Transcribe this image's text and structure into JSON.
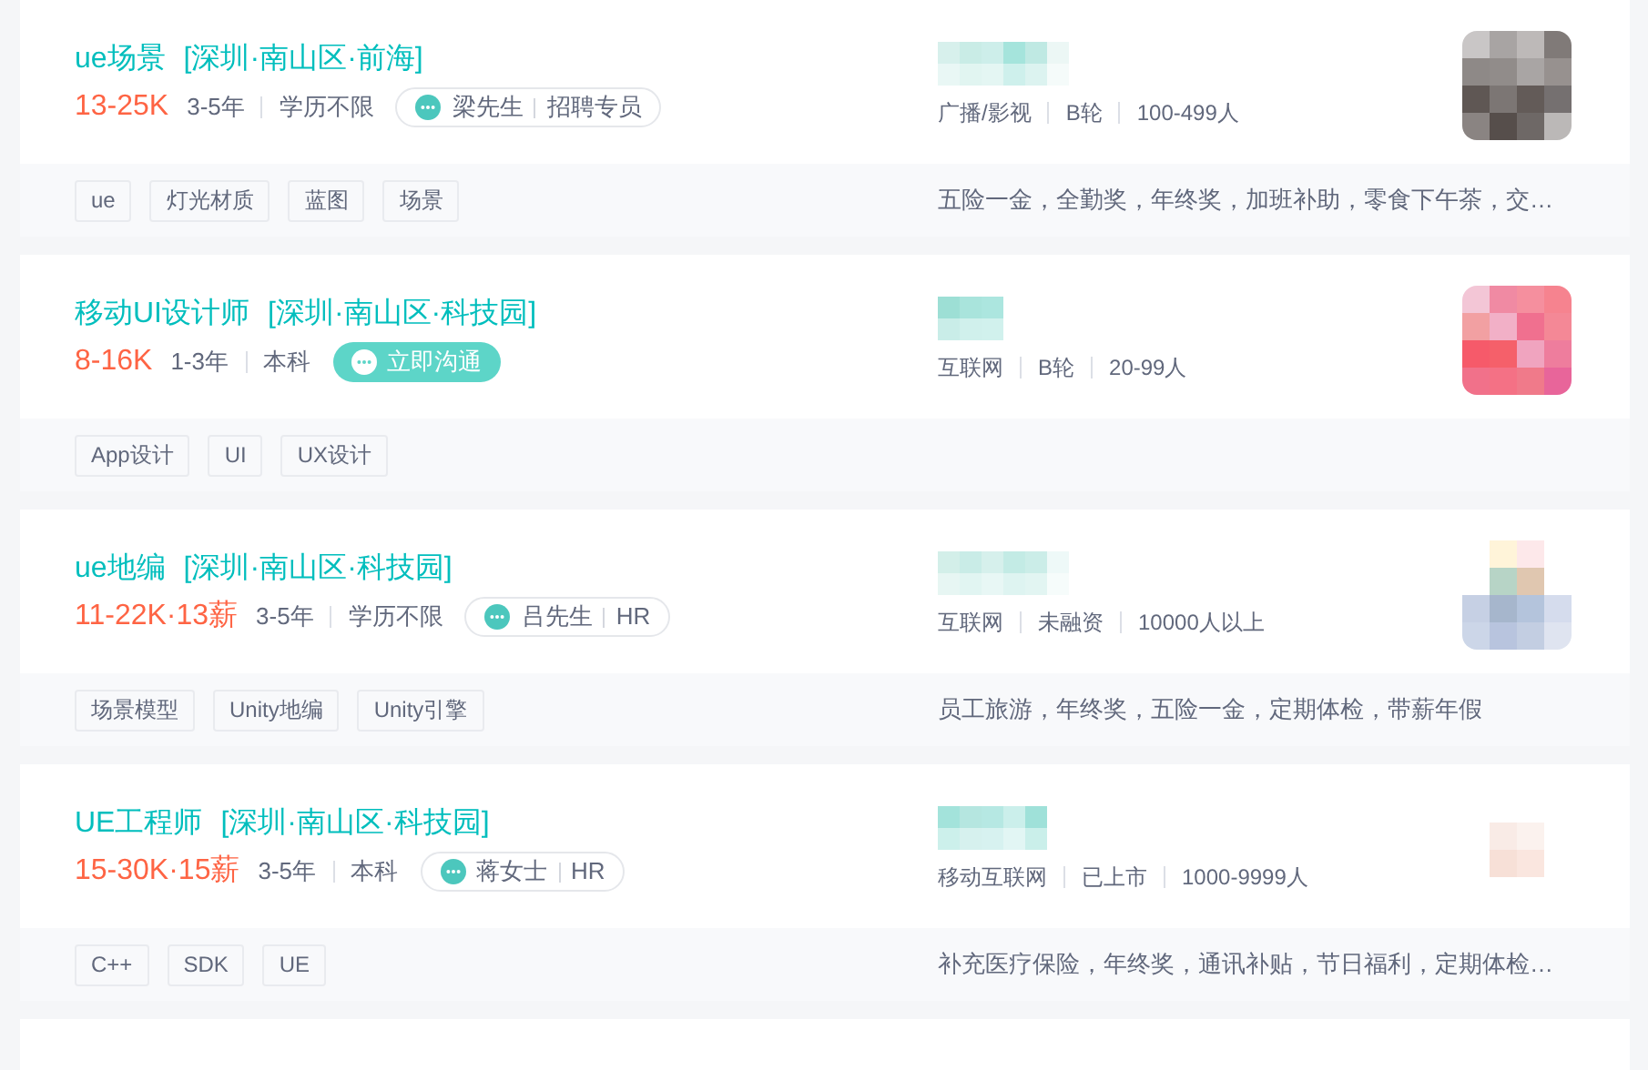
{
  "jobs": [
    {
      "title": "ue场景",
      "location": "[深圳·南山区·前海]",
      "salary": "13-25K",
      "experience": "3-5年",
      "education": "学历不限",
      "contact": {
        "kind": "recruiter",
        "name": "梁先生",
        "role": "招聘专员"
      },
      "company": {
        "industry": "广播/影视",
        "funding": "B轮",
        "size": "100-499人"
      },
      "tags": [
        "ue",
        "灯光材质",
        "蓝图",
        "场景"
      ],
      "benefits": "五险一金，全勤奖，年终奖，加班补助，零食下午茶，交…"
    },
    {
      "title": "移动UI设计师",
      "location": "[深圳·南山区·科技园]",
      "salary": "8-16K",
      "experience": "1-3年",
      "education": "本科",
      "contact": {
        "kind": "chat",
        "label": "立即沟通"
      },
      "company": {
        "industry": "互联网",
        "funding": "B轮",
        "size": "20-99人"
      },
      "tags": [
        "App设计",
        "UI",
        "UX设计"
      ]
    },
    {
      "title": "ue地编",
      "location": "[深圳·南山区·科技园]",
      "salary": "11-22K·13薪",
      "experience": "3-5年",
      "education": "学历不限",
      "contact": {
        "kind": "recruiter",
        "name": "吕先生",
        "role": "HR"
      },
      "company": {
        "industry": "互联网",
        "funding": "未融资",
        "size": "10000人以上"
      },
      "tags": [
        "场景模型",
        "Unity地编",
        "Unity引擎"
      ],
      "benefits": "员工旅游，年终奖，五险一金，定期体检，带薪年假"
    },
    {
      "title": "UE工程师",
      "location": "[深圳·南山区·科技园]",
      "salary": "15-30K·15薪",
      "experience": "3-5年",
      "education": "本科",
      "contact": {
        "kind": "recruiter",
        "name": "蒋女士",
        "role": "HR"
      },
      "company": {
        "industry": "移动互联网",
        "funding": "已上市",
        "size": "1000-9999人"
      },
      "tags": [
        "C++",
        "SDK",
        "UE"
      ],
      "benefits": "补充医疗保险，年终奖，通讯补贴，节日福利，定期体检…"
    }
  ]
}
